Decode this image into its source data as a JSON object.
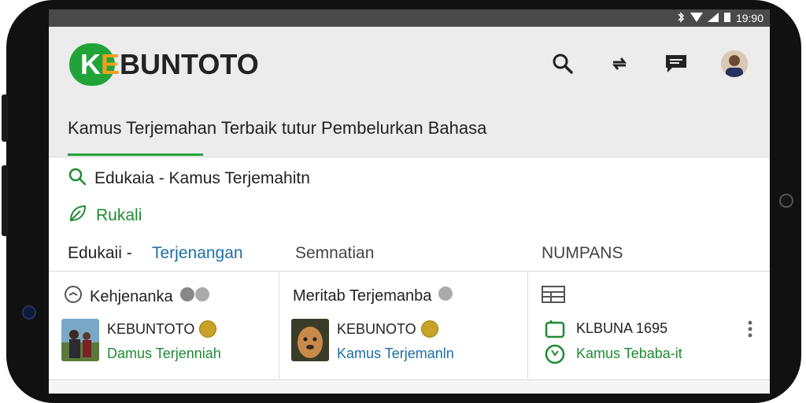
{
  "status_bar": {
    "time": "19:90"
  },
  "header": {
    "logo_text": "KEBUNTOTO",
    "subtitle": "Kamus Terjemahan Terbaik tutur Pembelurkan Bahasa",
    "icons": [
      "search-icon",
      "sync-icon",
      "chat-icon",
      "avatar"
    ]
  },
  "search_row": {
    "text": "Edukaia - Kamus Terjemahitn"
  },
  "rukali_row": {
    "text": "Rukali"
  },
  "sections": {
    "left_prefix": "Edukaii -",
    "left_link": "Terjenangan",
    "middle": "Semnatian",
    "right": "NUMPANS"
  },
  "cards": [
    {
      "title": "Kehjenanka",
      "brand": "KEBUNTOTO",
      "sub": "Damus Terjenniah"
    },
    {
      "title": "Meritab Terjemanba",
      "brand": "KEBUNOTO",
      "sub": "Kamus Terjemanln"
    },
    {
      "title": "",
      "brand": "KLBUNA 1695",
      "sub": "Kamus Tebaba-it"
    }
  ],
  "colors": {
    "accent_green": "#21a339",
    "link_blue": "#1b6fa6",
    "text_dark": "#222222"
  }
}
